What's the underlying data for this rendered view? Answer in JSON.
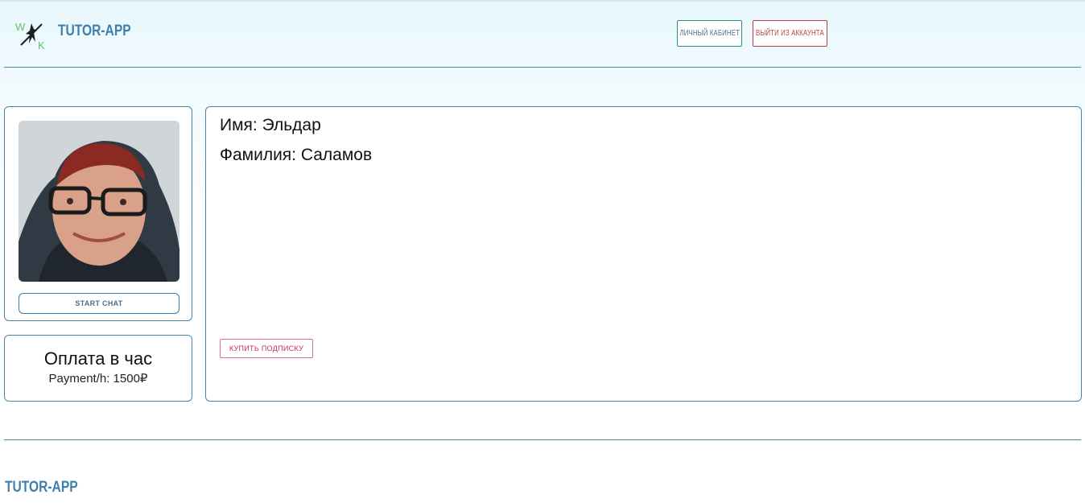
{
  "header": {
    "brand": "TUTOR-APP",
    "cabinet_label": "ЛИЧНЫЙ КАБИНЕТ",
    "logout_label": "ВЫЙТИ ИЗ АККАУНТА"
  },
  "profile": {
    "chat_label": "START CHAT",
    "pay_title": "Оплата в час",
    "pay_value": "Payment/h: 1500₽",
    "name_line": "Имя: Эльдар",
    "surname_line": "Фамилия: Саламов",
    "buy_label": "КУПИТЬ ПОДПИСКУ"
  },
  "footer": {
    "brand": "TUTOR-APP"
  },
  "colors": {
    "brand": "#3f7fae",
    "border": "#4b84a3",
    "logout": "#b83b3b",
    "buy": "#c2304f"
  }
}
